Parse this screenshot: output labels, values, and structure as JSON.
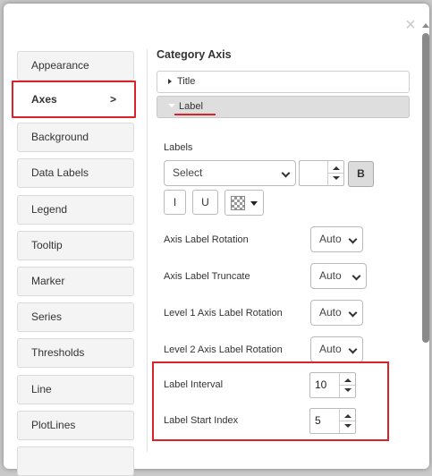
{
  "dialog": {
    "close_symbol": "×"
  },
  "sidebar": {
    "items": [
      {
        "label": "Appearance"
      },
      {
        "label": "Axes",
        "arrow": ">"
      },
      {
        "label": "Background"
      },
      {
        "label": "Data Labels"
      },
      {
        "label": "Legend"
      },
      {
        "label": "Tooltip"
      },
      {
        "label": "Marker"
      },
      {
        "label": "Series"
      },
      {
        "label": "Thresholds"
      },
      {
        "label": "Line"
      },
      {
        "label": "PlotLines"
      }
    ],
    "active": "Axes"
  },
  "panel": {
    "title": "Category Axis",
    "sections": [
      {
        "label": "Title",
        "state": "collapsed"
      },
      {
        "label": "Label",
        "state": "expanded"
      }
    ],
    "labels_heading": "Labels",
    "font_select": {
      "value": "Select"
    },
    "font_size": {
      "value": ""
    },
    "bold_label": "B",
    "italic_label": "I",
    "underline_label": "U",
    "fields": [
      {
        "label": "Axis Label Rotation",
        "value": "Auto"
      },
      {
        "label": "Axis Label Truncate",
        "value": "Auto"
      },
      {
        "label": "Level 1 Axis Label Rotation",
        "value": "Auto"
      },
      {
        "label": "Level 2 Axis Label Rotation",
        "value": "Auto"
      },
      {
        "label": "Label Interval",
        "value": "10"
      },
      {
        "label": "Label Start Index",
        "value": "5"
      }
    ]
  },
  "colors": {
    "accent_red": "#d8232a",
    "scrollbar": "#8a8a8a"
  }
}
